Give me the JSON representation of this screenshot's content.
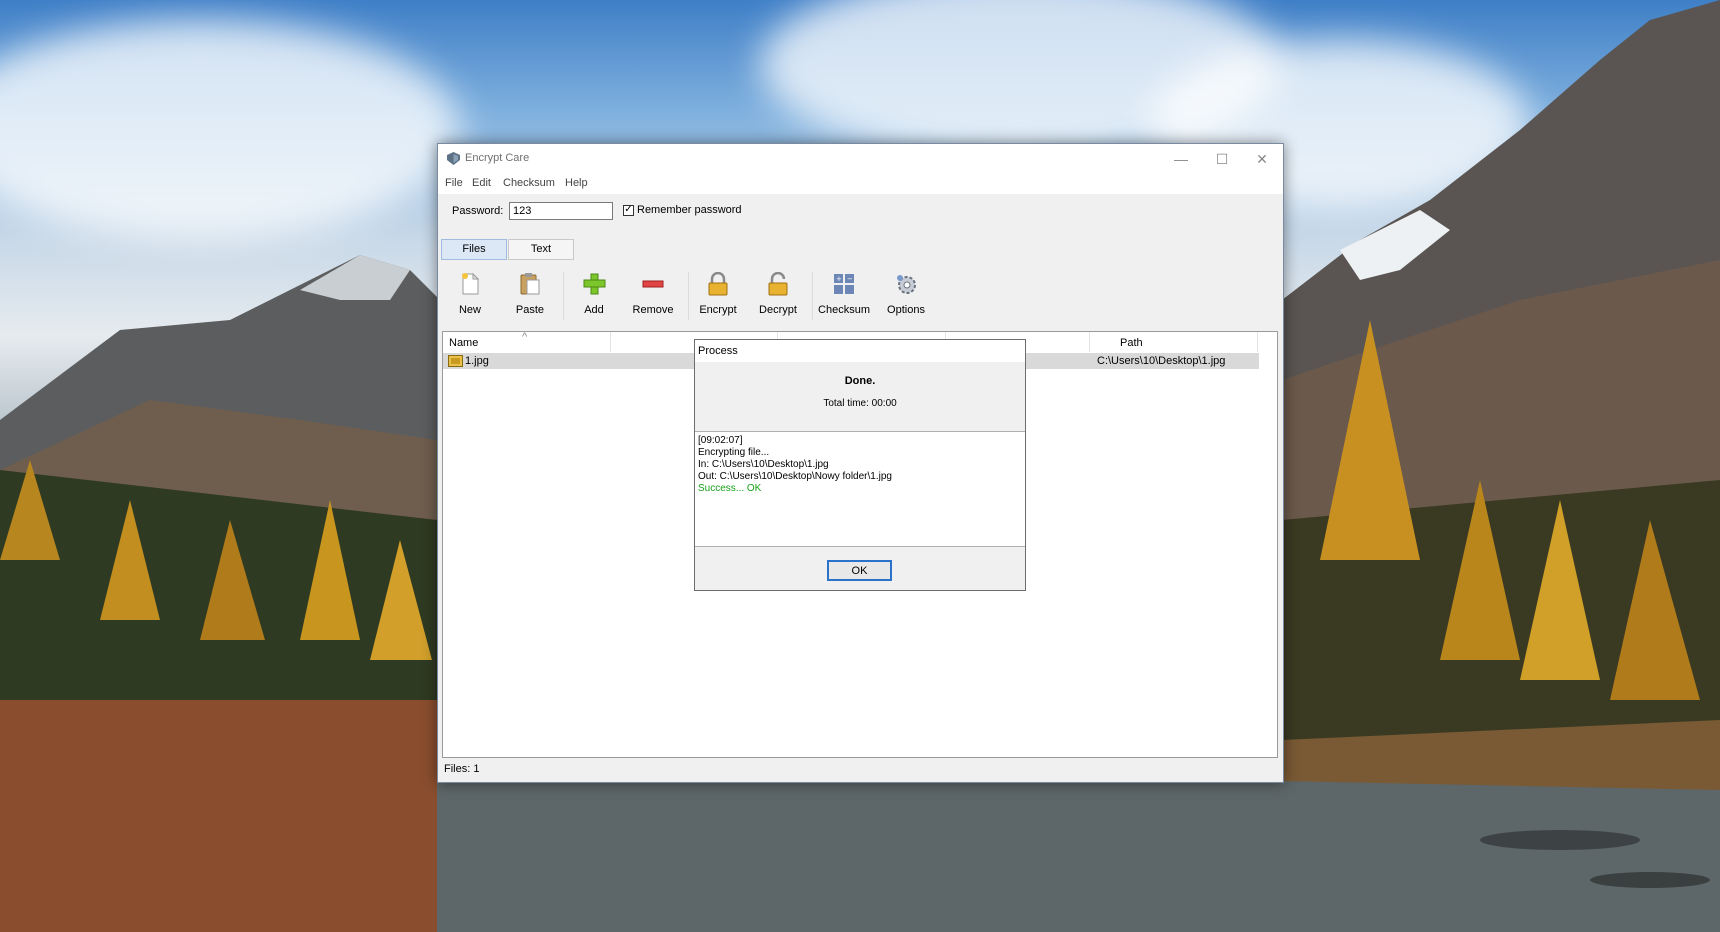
{
  "window": {
    "title": "Encrypt Care",
    "controls": {
      "minimize": "—",
      "maximize": "☐",
      "close": "✕"
    }
  },
  "menu": [
    "File",
    "Edit",
    "Checksum",
    "Help"
  ],
  "password": {
    "label": "Password:",
    "value": "123",
    "remember_label": "Remember password",
    "remember_checked": true
  },
  "tabs": [
    {
      "label": "Files",
      "active": true
    },
    {
      "label": "Text",
      "active": false
    }
  ],
  "toolbar": [
    {
      "label": "New",
      "icon": "new-file-icon"
    },
    {
      "label": "Paste",
      "icon": "paste-icon"
    },
    {
      "label": "Add",
      "icon": "add-plus-icon"
    },
    {
      "label": "Remove",
      "icon": "remove-minus-icon"
    },
    {
      "label": "Encrypt",
      "icon": "lock-icon"
    },
    {
      "label": "Decrypt",
      "icon": "unlock-icon"
    },
    {
      "label": "Checksum",
      "icon": "calculator-icon"
    },
    {
      "label": "Options",
      "icon": "gear-icon"
    }
  ],
  "file_list": {
    "columns": [
      "Name",
      "",
      "",
      "",
      "Path"
    ],
    "rows": [
      {
        "name": "1.jpg",
        "path": "C:\\Users\\10\\Desktop\\1.jpg"
      }
    ]
  },
  "status": {
    "files": "Files: 1"
  },
  "dialog": {
    "title": "Process",
    "headline": "Done.",
    "total_time": "Total time: 00:00",
    "log": [
      "[09:02:07]",
      "Encrypting file...",
      "In: C:\\Users\\10\\Desktop\\1.jpg",
      "Out: C:\\Users\\10\\Desktop\\Nowy folder\\1.jpg"
    ],
    "result": "Success... OK",
    "ok_label": "OK"
  },
  "colors": {
    "accent": "#2a73c9",
    "selected_row": "#d9d9d9",
    "success": "#1aa01a",
    "active_tab": "#dce8f6"
  }
}
